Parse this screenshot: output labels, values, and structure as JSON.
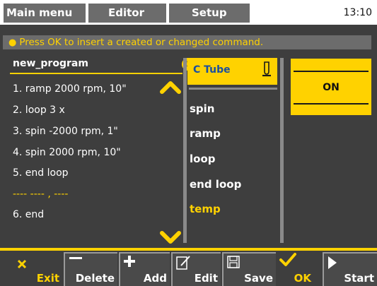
{
  "header": {
    "tabs": [
      {
        "label": "Main menu"
      },
      {
        "label": "Editor"
      },
      {
        "label": "Setup"
      }
    ],
    "clock": "13:10"
  },
  "info": {
    "message": "Press OK to insert a created or changed command."
  },
  "program": {
    "title": "new_program",
    "steps": [
      "1. ramp 2000 rpm, 10\"",
      "2. loop 3 x",
      "3. spin -2000 rpm, 1\"",
      "4. spin 2000 rpm, 10\"",
      "5. end loop",
      "6. end"
    ],
    "insert_placeholder": "---- ---- , ----"
  },
  "commands": {
    "selected": "C Tube",
    "items": [
      "spin",
      "ramp",
      "loop",
      "end loop",
      "temp"
    ]
  },
  "status": {
    "on_label": "ON"
  },
  "toolbar": {
    "exit_label": "Exit",
    "delete_label": "Delete",
    "add_label": "Add",
    "edit_label": "Edit",
    "save_label": "Save",
    "ok_label": "OK",
    "start_label": "Start"
  },
  "colors": {
    "background": "#3e3e3e",
    "accent_yellow": "#ffd200",
    "tab_gray": "#6c6c6c",
    "selected_text_blue": "#1a4fa0"
  }
}
